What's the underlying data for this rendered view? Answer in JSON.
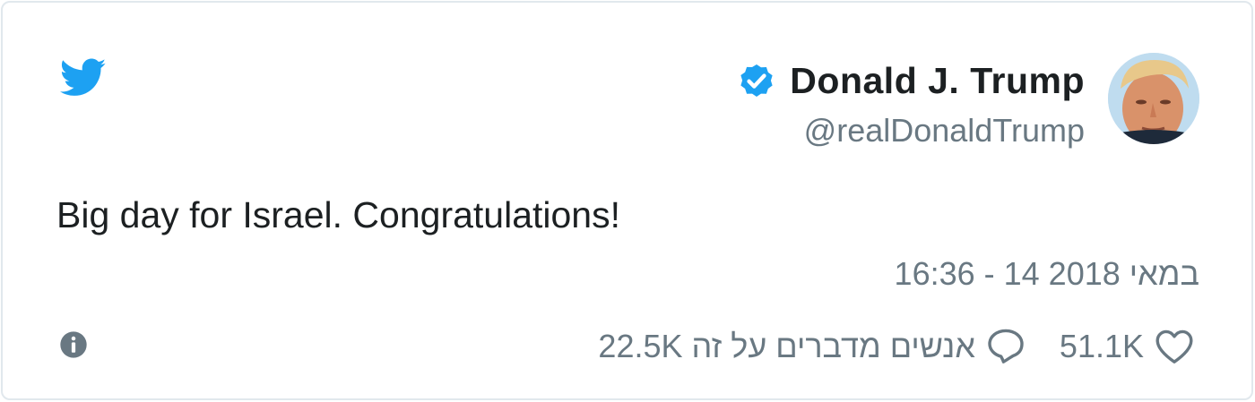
{
  "tweet": {
    "author": {
      "display_name": "Donald J. Trump",
      "handle": "@realDonaldTrump",
      "verified": true
    },
    "text": "Big day for Israel. Congratulations!",
    "timestamp": "16:36 - 14 במאי 2018",
    "replies_text": "22.5K אנשים מדברים על זה",
    "likes": "51.1K"
  },
  "icons": {
    "brand": "twitter-bird-icon",
    "verified": "verified-badge-icon",
    "info": "info-icon",
    "reply": "speech-bubble-icon",
    "like": "heart-icon"
  },
  "colors": {
    "twitter_blue": "#1da1f2",
    "text": "#1c2022",
    "muted": "#697882",
    "border": "#e1e8ed"
  }
}
